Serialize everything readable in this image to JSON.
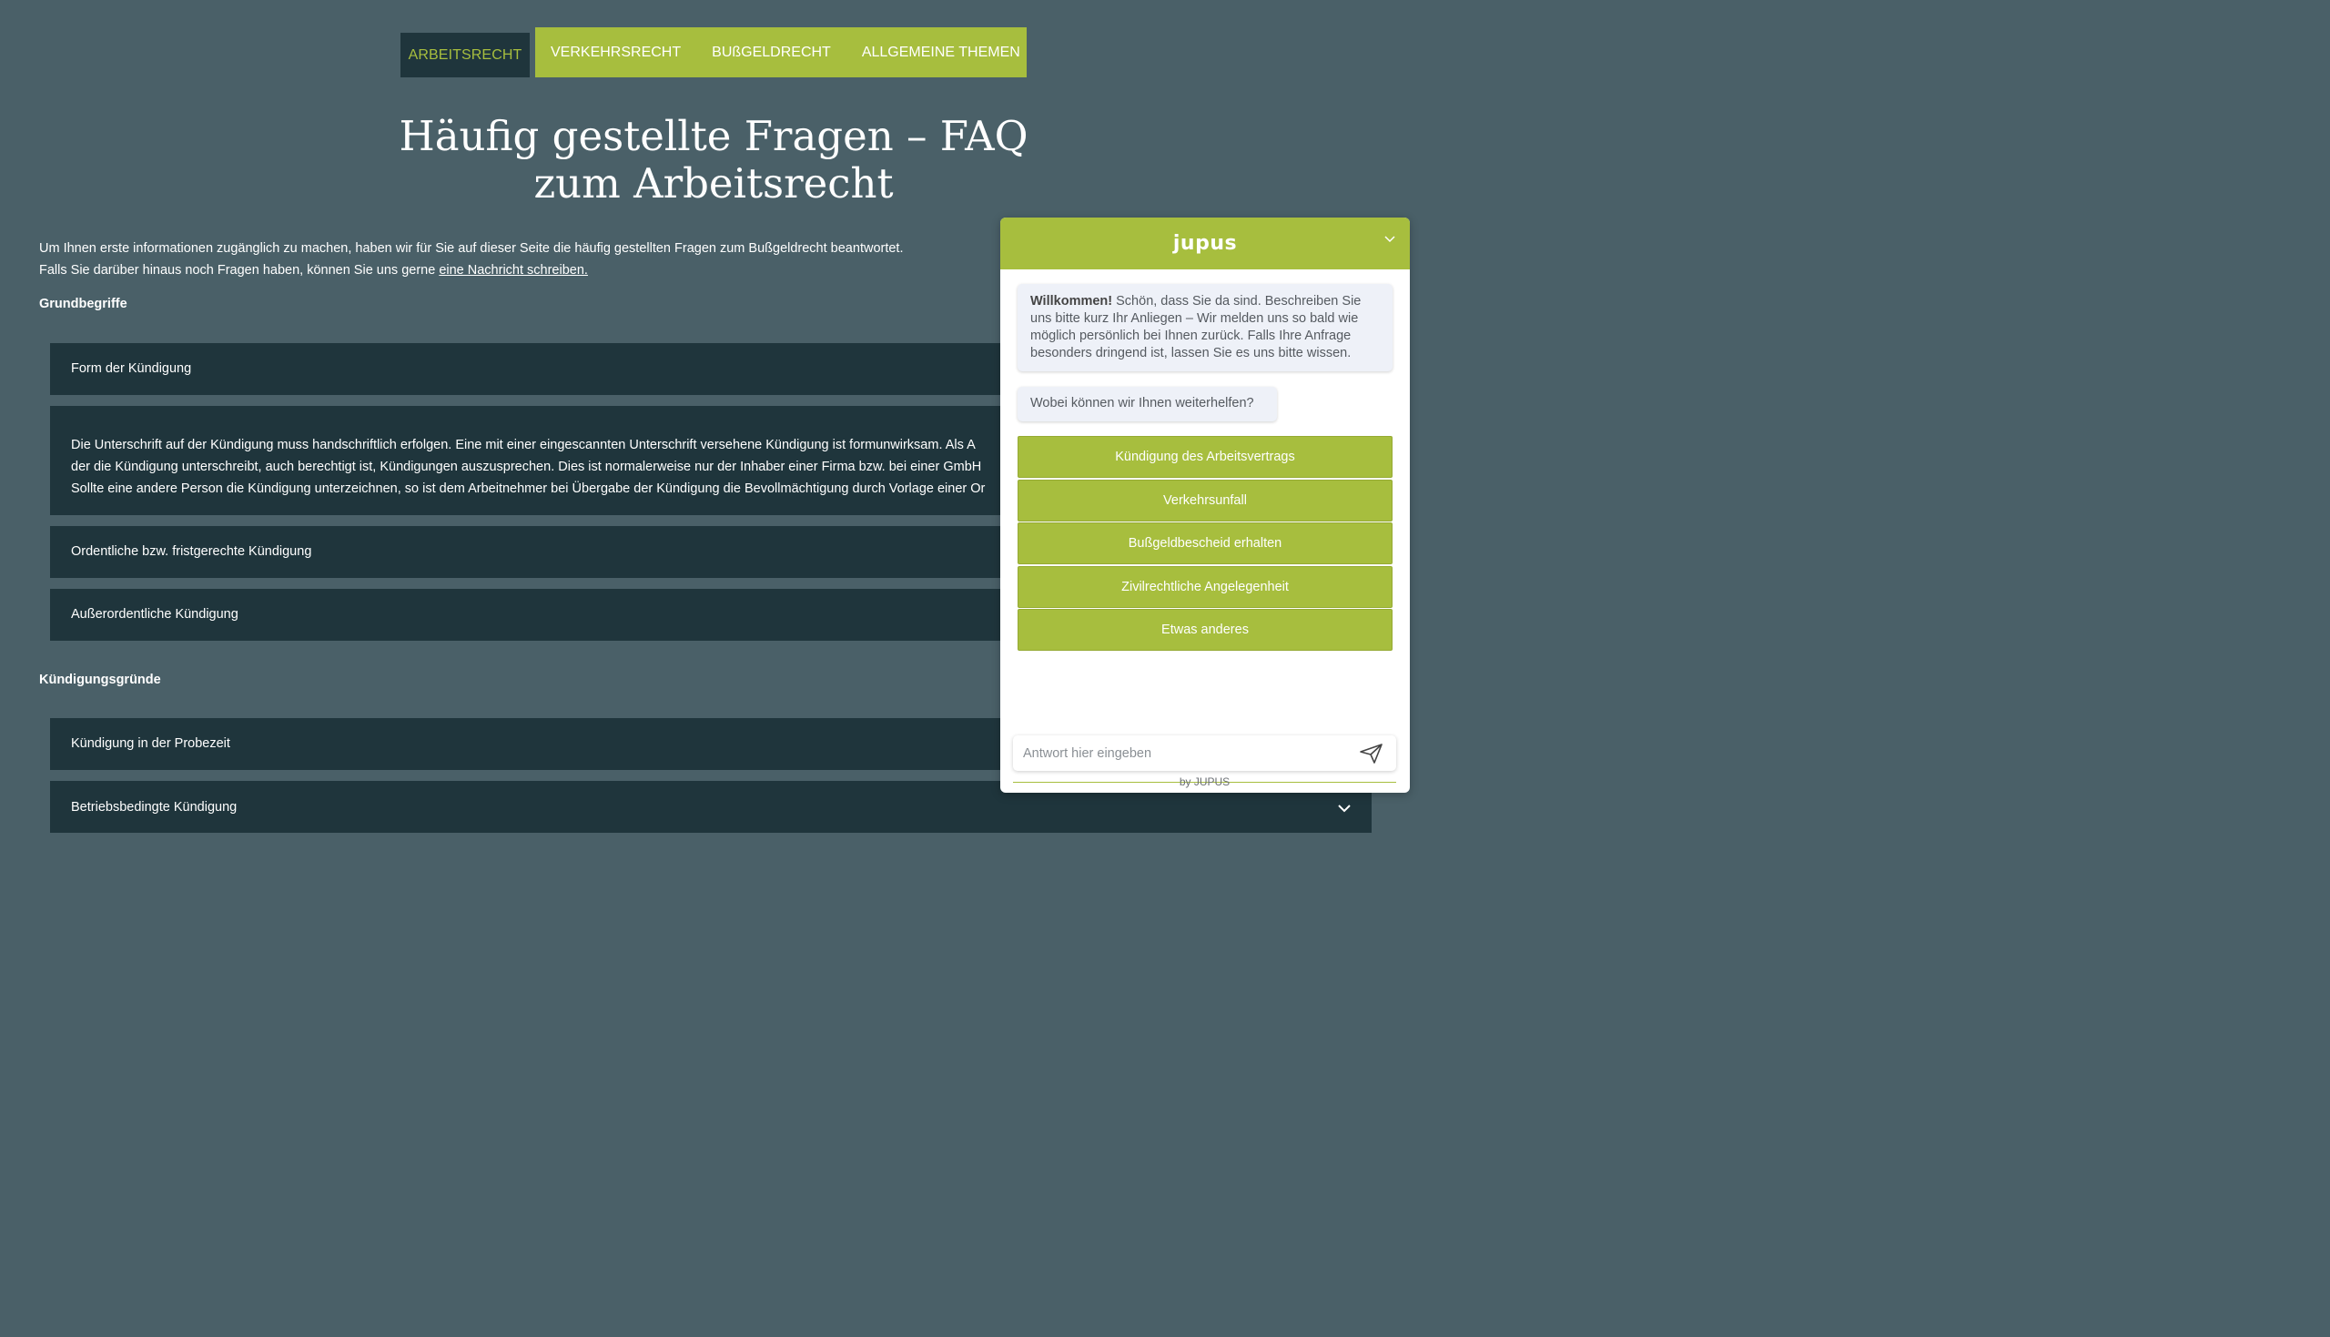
{
  "nav": {
    "tabs": [
      {
        "label": "ARBEITSRECHT",
        "active": true
      },
      {
        "label": "VERKEHRSRECHT",
        "active": false
      },
      {
        "label": "BUSSGELDRECHT",
        "active": false
      },
      {
        "label": "ALLGEMEINE THEMEN",
        "active": false
      }
    ]
  },
  "page": {
    "title_line1": "Häufig gestellte Fragen – FAQ",
    "title_line2": "zum Arbeitsrecht",
    "intro_line1": "Um Ihnen erste informationen zugänglich zu machen, haben wir für Sie auf dieser Seite die häufig gestellten Fragen zum Bußgeldrecht beantwortet.",
    "intro_line2_prefix": "Falls Sie darüber hinaus noch Fragen haben, können Sie uns gerne ",
    "intro_link": "eine Nachricht schreiben."
  },
  "sections": [
    {
      "heading": "Grundbegriffe",
      "items": [
        {
          "label": "Form der Kündigung",
          "expanded": false
        },
        {
          "label": "",
          "expanded": true,
          "answer_lines": [
            "Die Unterschrift auf der Kündigung muss handschriftlich erfolgen. Eine mit einer eingescannten Unterschrift versehene Kündigung ist formunwirksam. Als A",
            "der die Kündigung unterschreibt, auch berechtigt ist, Kündigungen auszusprechen. Dies ist normalerweise nur der Inhaber einer Firma bzw. bei einer GmbH",
            "Sollte eine andere Person die Kündigung unterzeichnen, so ist dem Arbeitnehmer bei Übergabe der Kündigung die Bevollmächtigung durch Vorlage einer Or"
          ]
        },
        {
          "label": "Ordentliche bzw. fristgerechte Kündigung",
          "expanded": false
        },
        {
          "label": "Außerordentliche Kündigung",
          "expanded": false
        }
      ]
    },
    {
      "heading": "Kündigungsgründe",
      "items": [
        {
          "label": "Kündigung in der Probezeit",
          "expanded": false
        },
        {
          "label": "Betriebsbedingte Kündigung",
          "expanded": false
        }
      ]
    }
  ],
  "chat": {
    "brand": "jupus",
    "welcome_bold": "Willkommen!",
    "welcome_text": " Schön, dass Sie da sind. Beschreiben Sie uns bitte kurz Ihr Anliegen – Wir melden uns so bald wie möglich persönlich bei Ihnen zurück. Falls Ihre Anfrage besonders dringend ist, lassen Sie es uns bitte wissen.",
    "question": "Wobei können wir Ihnen weiterhelfen?",
    "options": [
      "Kündigung des Arbeitsvertrags",
      "Verkehrsunfall",
      "Bußgeldbescheid erhalten",
      "Zivilrechtliche Angelegenheit",
      "Etwas anderes"
    ],
    "input_placeholder": "Antwort hier eingeben",
    "powered_by": "by JUPUS"
  },
  "colors": {
    "background": "#4a6068",
    "panel": "#1f353c",
    "accent": "#a7be3e"
  }
}
